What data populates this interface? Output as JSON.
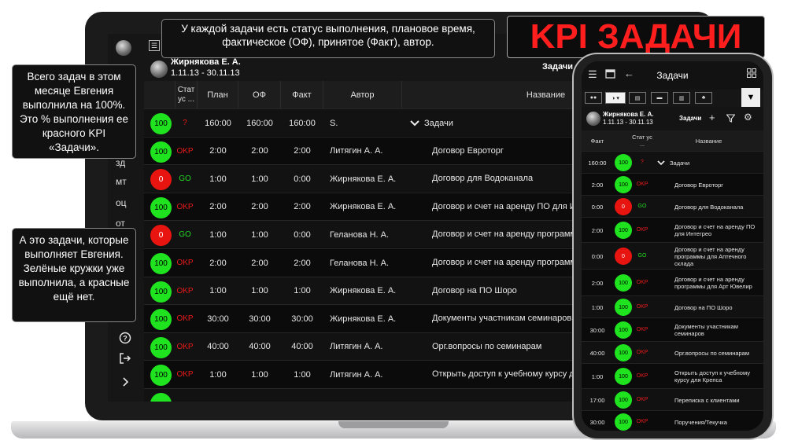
{
  "laptop": {
    "sidebar": {
      "items": [
        "зд",
        "мт",
        "оц",
        "от"
      ]
    },
    "header": {
      "menu_icon": "list-icon",
      "user_name": "Жирнякова Е. А.",
      "period": "1.11.13 - 30.11.13",
      "section": "Задачи"
    },
    "columns": [
      "Стат ус ...",
      "План",
      "ОФ",
      "Факт",
      "Автор",
      "Название"
    ],
    "rows": [
      {
        "score": "100",
        "status": "?",
        "plan": "160:00",
        "of": "160:00",
        "fact": "160:00",
        "author": "S.",
        "name": "Задачи",
        "group": true
      },
      {
        "score": "100",
        "status": "OKP",
        "plan": "2:00",
        "of": "2:00",
        "fact": "2:00",
        "author": "Литягин А. А.",
        "name": "Договор Евроторг"
      },
      {
        "score": "0",
        "status": "GO",
        "plan": "1:00",
        "of": "1:00",
        "fact": "0:00",
        "author": "Жирнякова Е. А.",
        "name": "Договор для Водоканала"
      },
      {
        "score": "100",
        "status": "OKP",
        "plan": "2:00",
        "of": "2:00",
        "fact": "2:00",
        "author": "Жирнякова Е. А.",
        "name": "Договор и счет на аренду ПО для И"
      },
      {
        "score": "0",
        "status": "GO",
        "plan": "1:00",
        "of": "1:00",
        "fact": "0:00",
        "author": "Геланова Н. А.",
        "name": "Договор и счет на аренду программ склада"
      },
      {
        "score": "100",
        "status": "OKP",
        "plan": "2:00",
        "of": "2:00",
        "fact": "2:00",
        "author": "Геланова Н. А.",
        "name": "Договор и счет на аренду программ Ювелир"
      },
      {
        "score": "100",
        "status": "OKP",
        "plan": "1:00",
        "of": "1:00",
        "fact": "1:00",
        "author": "Жирнякова Е. А.",
        "name": "Договор на ПО Шоро"
      },
      {
        "score": "100",
        "status": "OKP",
        "plan": "30:00",
        "of": "30:00",
        "fact": "30:00",
        "author": "Жирнякова Е. А.",
        "name": "Документы участникам семинаров"
      },
      {
        "score": "100",
        "status": "OKP",
        "plan": "40:00",
        "of": "40:00",
        "fact": "40:00",
        "author": "Литягин А. А.",
        "name": "Орг.вопросы по семинарам"
      },
      {
        "score": "100",
        "status": "OKP",
        "plan": "1:00",
        "of": "1:00",
        "fact": "1:00",
        "author": "Литягин А. А.",
        "name": "Открыть доступ к учебному курсу д"
      }
    ]
  },
  "callouts": {
    "top": "У каждой задачи есть статус выполнения, плановое время, фактическое (ОФ), принятое (Факт), автор.",
    "left1": "Всего задач в этом месяце Евгения выполнила на 100%. Это % выполнения ее красного KPI «Задачи».",
    "left2": "А это задачи, которые выполняет Евгения. Зелёные кружки уже выполнила, а красные ещё нет.",
    "title": "KPI ЗАДАЧИ"
  },
  "phone": {
    "title": "Задачи",
    "user_name": "Жирнякова Е. А.",
    "period": "1.11.13 - 30.11.13",
    "section": "Задачи",
    "add_icon": "+",
    "columns": [
      "Факт",
      "Стат ус ...",
      "Название"
    ],
    "rows": [
      {
        "fact": "160:00",
        "score": "100",
        "status": "?",
        "name": "Задачи",
        "group": true
      },
      {
        "fact": "2:00",
        "score": "100",
        "status": "OKP",
        "name": "Договор Евроторг"
      },
      {
        "fact": "0:00",
        "score": "0",
        "status": "GO",
        "name": "Договор для Водоканала"
      },
      {
        "fact": "2:00",
        "score": "100",
        "status": "OKP",
        "name": "Договор и счет на аренду ПО для Интегрео"
      },
      {
        "fact": "0:00",
        "score": "0",
        "status": "GO",
        "name": "Договор и счет на аренду программы для Аптечного склада"
      },
      {
        "fact": "2:00",
        "score": "100",
        "status": "OKP",
        "name": "Договор и счет на аренду программы для Арт Ювелир"
      },
      {
        "fact": "1:00",
        "score": "100",
        "status": "OKP",
        "name": "Договор на ПО Шоро"
      },
      {
        "fact": "30:00",
        "score": "100",
        "status": "OKP",
        "name": "Документы участникам семинаров"
      },
      {
        "fact": "40:00",
        "score": "100",
        "status": "OKP",
        "name": "Орг.вопросы по семинарам"
      },
      {
        "fact": "1:00",
        "score": "100",
        "status": "OKP",
        "name": "Открыть доступ к учебному курсу для Крепса"
      },
      {
        "fact": "17:00",
        "score": "100",
        "status": "OKP",
        "name": "Переписка с клиентами"
      },
      {
        "fact": "30:00",
        "score": "100",
        "status": "OKP",
        "name": "Поручения/Текучка"
      }
    ]
  },
  "colors": {
    "green": "#20e320",
    "red": "#e8140f",
    "accent_title": "#ff1e1e"
  }
}
